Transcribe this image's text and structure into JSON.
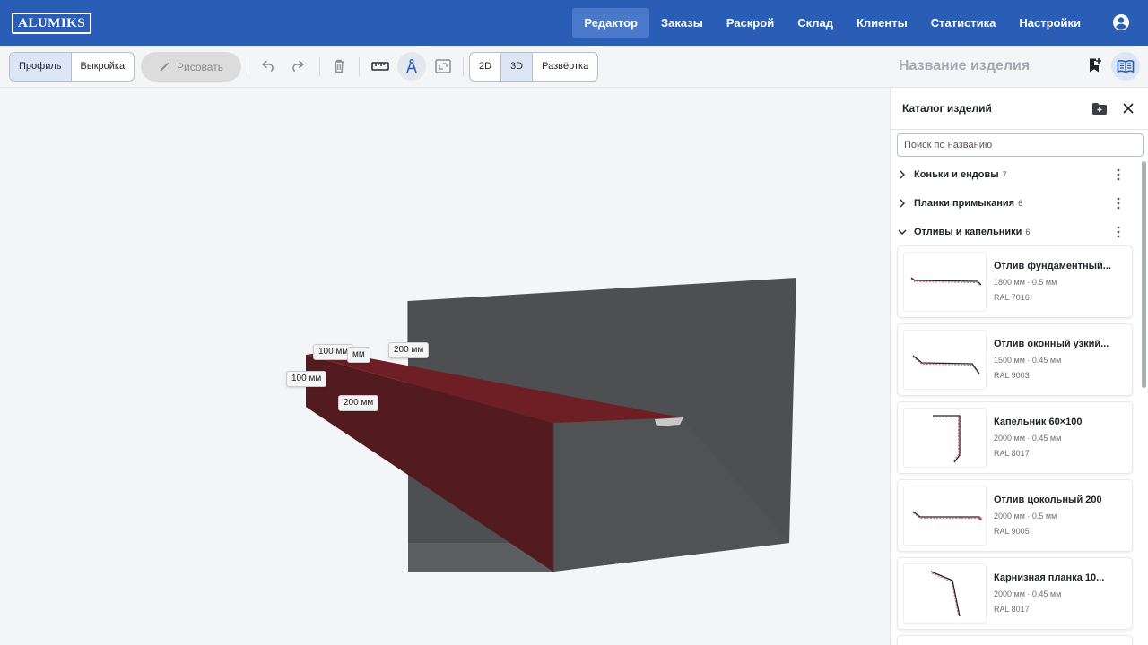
{
  "app": {
    "logo_text": "ALUMIKS"
  },
  "nav": {
    "items": [
      {
        "label": "Редактор",
        "active": true
      },
      {
        "label": "Заказы",
        "active": false
      },
      {
        "label": "Раскрой",
        "active": false
      },
      {
        "label": "Склад",
        "active": false
      },
      {
        "label": "Клиенты",
        "active": false
      },
      {
        "label": "Статистика",
        "active": false
      },
      {
        "label": "Настройки",
        "active": false
      }
    ],
    "account_icon": "account-circle-icon"
  },
  "toolbar": {
    "mode_tabs": [
      {
        "label": "Профиль",
        "active": true
      },
      {
        "label": "Выкройка",
        "active": false
      }
    ],
    "draw_label": "Рисовать",
    "view_tabs": [
      {
        "label": "2D",
        "active": false
      },
      {
        "label": "3D",
        "active": true
      },
      {
        "label": "Развёртка",
        "active": false
      }
    ],
    "icons": [
      "undo-icon",
      "redo-icon",
      "delete-icon",
      "ruler-icon",
      "compass-icon",
      "fit-view-icon"
    ]
  },
  "header": {
    "product_name_placeholder": "Название изделия"
  },
  "canvas": {
    "dimensions": [
      {
        "label": "100 мм"
      },
      {
        "label": "мм"
      },
      {
        "label": "200 мм"
      },
      {
        "label": "100 мм"
      },
      {
        "label": "200 мм"
      }
    ],
    "colors": {
      "profile_red": "#6b1d22",
      "profile_gray": "#4a4c4e"
    }
  },
  "catalog": {
    "title": "Каталог изделий",
    "search_placeholder": "Поиск по названию",
    "groups": [
      {
        "name": "Коньки и ендовы",
        "count": "7",
        "expanded": false
      },
      {
        "name": "Планки примыкания",
        "count": "6",
        "expanded": false
      },
      {
        "name": "Отливы и капельники",
        "count": "6",
        "expanded": true
      }
    ],
    "items": [
      {
        "name": "Отлив фундаментный...",
        "spec": "1800 мм · 0.5 мм",
        "ral": "RAL 7016"
      },
      {
        "name": "Отлив оконный узкий...",
        "spec": "1500 мм · 0.45 мм",
        "ral": "RAL 9003"
      },
      {
        "name": "Капельник 60×100",
        "spec": "2000 мм · 0.45 мм",
        "ral": "RAL 8017"
      },
      {
        "name": "Отлив цокольный 200",
        "spec": "2000 мм · 0.5 мм",
        "ral": "RAL 9005"
      },
      {
        "name": "Карнизная планка 10...",
        "spec": "2000 мм · 0.45 мм",
        "ral": "RAL 8017"
      }
    ]
  }
}
